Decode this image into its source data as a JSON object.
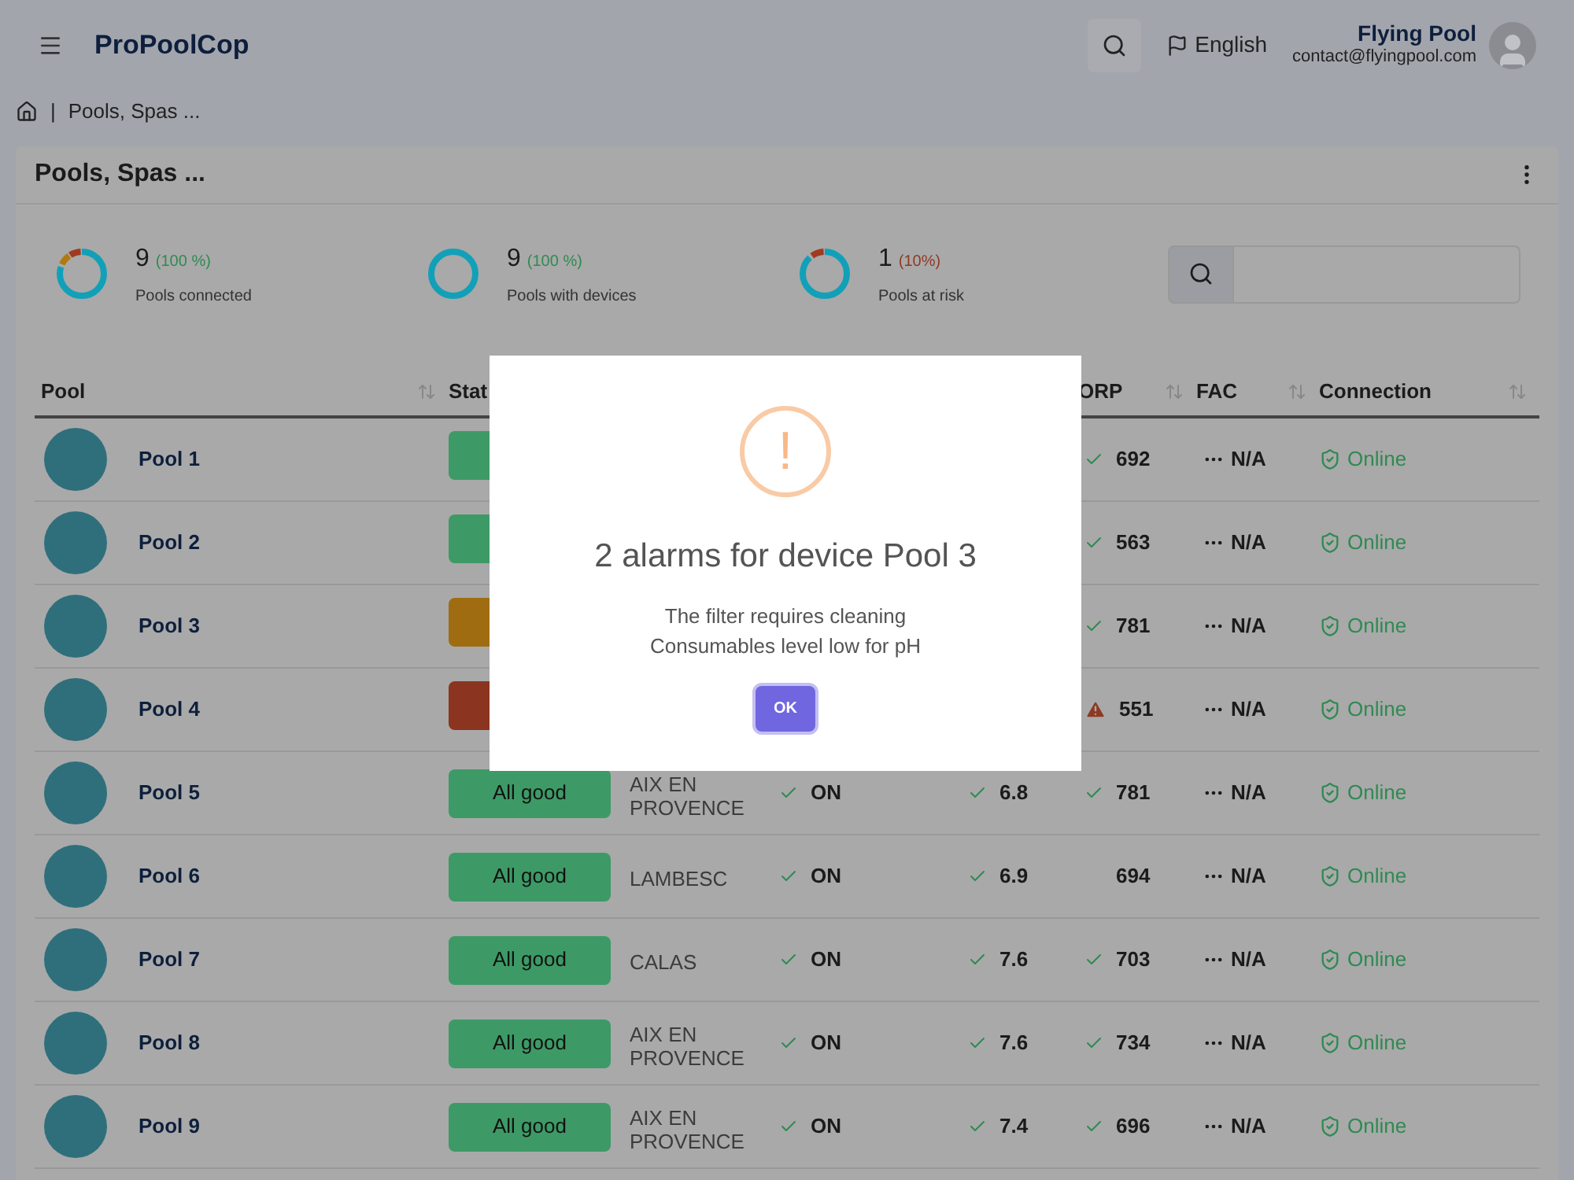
{
  "topbar": {
    "logo": "ProPoolCop",
    "language": "English",
    "user_name": "Flying Pool",
    "user_email": "contact@flyingpool.com"
  },
  "breadcrumb": {
    "separator": "|",
    "current": "Pools, Spas ..."
  },
  "card": {
    "title": "Pools, Spas ...",
    "stats": [
      {
        "kind": "mixed",
        "count": "9",
        "percent": "(100 %)",
        "color": "#2f8a52",
        "label": "Pools connected"
      },
      {
        "kind": "full",
        "count": "9",
        "percent": "(100 %)",
        "color": "#2f8a52",
        "label": "Pools with devices"
      },
      {
        "kind": "risk",
        "count": "1",
        "percent": "(10%)",
        "color": "#8e3a22",
        "label": "Pools at risk"
      }
    ],
    "table": {
      "columns": [
        "Pool",
        "Stat",
        "",
        "",
        "",
        "ORP",
        "FAC",
        "Connection"
      ],
      "rows": [
        {
          "pool": "Pool 1",
          "status": {
            "color": "#3d9a66"
          },
          "city": "",
          "pump": "",
          "ph": "",
          "orp": {
            "value": "692",
            "kind": "ok"
          },
          "fac": "N/A",
          "connection": "Online"
        },
        {
          "pool": "Pool 2",
          "status": {
            "color": "#3d9a66"
          },
          "city": "",
          "pump": "",
          "ph": "",
          "orp": {
            "value": "563",
            "kind": "ok"
          },
          "fac": "N/A",
          "connection": "Online"
        },
        {
          "pool": "Pool 3",
          "status": {
            "color": "#a06c12"
          },
          "city": "",
          "pump": "",
          "ph": "",
          "orp": {
            "value": "781",
            "kind": "ok"
          },
          "fac": "N/A",
          "connection": "Online"
        },
        {
          "pool": "Pool 4",
          "status": {
            "color": "#8b3520"
          },
          "city": "",
          "pump": "",
          "ph": "",
          "orp": {
            "value": "551",
            "kind": "warn"
          },
          "fac": "N/A",
          "connection": "Online"
        },
        {
          "pool": "Pool 5",
          "status": {
            "label": "All good",
            "color": "#3d9a66"
          },
          "city": "AIX EN PROVENCE",
          "pump": "ON",
          "ph": "6.8",
          "orp": {
            "value": "781",
            "kind": "ok"
          },
          "fac": "N/A",
          "connection": "Online"
        },
        {
          "pool": "Pool 6",
          "status": {
            "label": "All good",
            "color": "#3d9a66"
          },
          "city": "LAMBESC",
          "pump": "ON",
          "ph": "6.9",
          "orp": {
            "value": "694",
            "kind": "none"
          },
          "fac": "N/A",
          "connection": "Online"
        },
        {
          "pool": "Pool 7",
          "status": {
            "label": "All good",
            "color": "#3d9a66"
          },
          "city": "CALAS",
          "pump": "ON",
          "ph": "7.6",
          "orp": {
            "value": "703",
            "kind": "ok"
          },
          "fac": "N/A",
          "connection": "Online"
        },
        {
          "pool": "Pool 8",
          "status": {
            "label": "All good",
            "color": "#3d9a66"
          },
          "city": "AIX EN PROVENCE",
          "pump": "ON",
          "ph": "7.6",
          "orp": {
            "value": "734",
            "kind": "ok"
          },
          "fac": "N/A",
          "connection": "Online"
        },
        {
          "pool": "Pool 9",
          "status": {
            "label": "All good",
            "color": "#3d9a66"
          },
          "city": "AIX EN PROVENCE",
          "pump": "ON",
          "ph": "7.4",
          "orp": {
            "value": "696",
            "kind": "ok"
          },
          "fac": "N/A",
          "connection": "Online"
        }
      ]
    }
  },
  "dialog": {
    "icon": "!",
    "title": "2 alarms for device Pool 3",
    "lines": [
      "The filter requires cleaning",
      "Consumables level low for pH"
    ],
    "button": "OK"
  }
}
